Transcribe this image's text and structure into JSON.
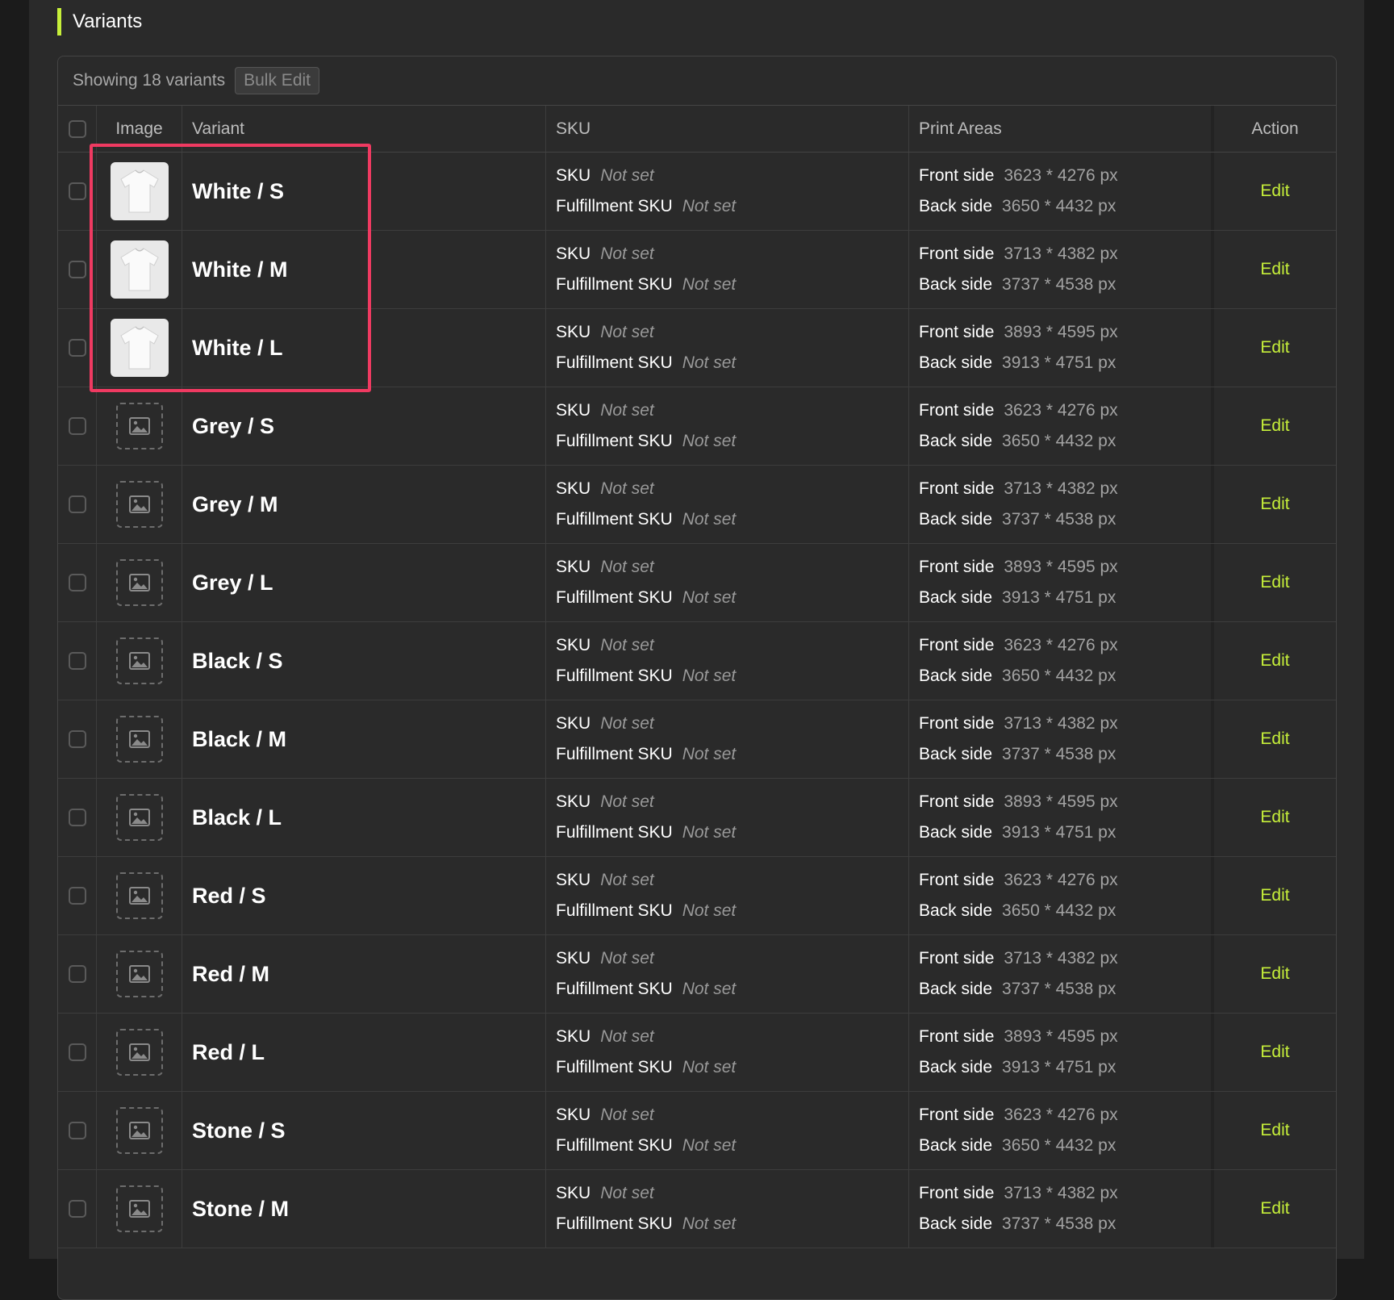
{
  "section": {
    "title": "Variants"
  },
  "toolbar": {
    "showing": "Showing 18 variants",
    "bulk_edit": "Bulk Edit"
  },
  "columns": {
    "image": "Image",
    "variant": "Variant",
    "sku": "SKU",
    "print_areas": "Print Areas",
    "action": "Action"
  },
  "colors": {
    "accent": "#c6ef3a",
    "highlight": "#ef3a61",
    "background": "#2a2a2a"
  },
  "rows": [
    {
      "variant": "White / S",
      "image": "white-tshirt",
      "sku_label": "SKU",
      "sku": "Not set",
      "fsku_label": "Fulfillment SKU",
      "fsku": "Not set",
      "front_label": "Front side",
      "front": "3623 * 4276 px",
      "back_label": "Back side",
      "back": "3650 * 4432 px",
      "action": "Edit"
    },
    {
      "variant": "White / M",
      "image": "white-tshirt",
      "sku_label": "SKU",
      "sku": "Not set",
      "fsku_label": "Fulfillment SKU",
      "fsku": "Not set",
      "front_label": "Front side",
      "front": "3713 * 4382 px",
      "back_label": "Back side",
      "back": "3737 * 4538 px",
      "action": "Edit"
    },
    {
      "variant": "White / L",
      "image": "white-tshirt",
      "sku_label": "SKU",
      "sku": "Not set",
      "fsku_label": "Fulfillment SKU",
      "fsku": "Not set",
      "front_label": "Front side",
      "front": "3893 * 4595 px",
      "back_label": "Back side",
      "back": "3913 * 4751 px",
      "action": "Edit"
    },
    {
      "variant": "Grey / S",
      "image": "placeholder",
      "sku_label": "SKU",
      "sku": "Not set",
      "fsku_label": "Fulfillment SKU",
      "fsku": "Not set",
      "front_label": "Front side",
      "front": "3623 * 4276 px",
      "back_label": "Back side",
      "back": "3650 * 4432 px",
      "action": "Edit"
    },
    {
      "variant": "Grey / M",
      "image": "placeholder",
      "sku_label": "SKU",
      "sku": "Not set",
      "fsku_label": "Fulfillment SKU",
      "fsku": "Not set",
      "front_label": "Front side",
      "front": "3713 * 4382 px",
      "back_label": "Back side",
      "back": "3737 * 4538 px",
      "action": "Edit"
    },
    {
      "variant": "Grey / L",
      "image": "placeholder",
      "sku_label": "SKU",
      "sku": "Not set",
      "fsku_label": "Fulfillment SKU",
      "fsku": "Not set",
      "front_label": "Front side",
      "front": "3893 * 4595 px",
      "back_label": "Back side",
      "back": "3913 * 4751 px",
      "action": "Edit"
    },
    {
      "variant": "Black / S",
      "image": "placeholder",
      "sku_label": "SKU",
      "sku": "Not set",
      "fsku_label": "Fulfillment SKU",
      "fsku": "Not set",
      "front_label": "Front side",
      "front": "3623 * 4276 px",
      "back_label": "Back side",
      "back": "3650 * 4432 px",
      "action": "Edit"
    },
    {
      "variant": "Black / M",
      "image": "placeholder",
      "sku_label": "SKU",
      "sku": "Not set",
      "fsku_label": "Fulfillment SKU",
      "fsku": "Not set",
      "front_label": "Front side",
      "front": "3713 * 4382 px",
      "back_label": "Back side",
      "back": "3737 * 4538 px",
      "action": "Edit"
    },
    {
      "variant": "Black / L",
      "image": "placeholder",
      "sku_label": "SKU",
      "sku": "Not set",
      "fsku_label": "Fulfillment SKU",
      "fsku": "Not set",
      "front_label": "Front side",
      "front": "3893 * 4595 px",
      "back_label": "Back side",
      "back": "3913 * 4751 px",
      "action": "Edit"
    },
    {
      "variant": "Red / S",
      "image": "placeholder",
      "sku_label": "SKU",
      "sku": "Not set",
      "fsku_label": "Fulfillment SKU",
      "fsku": "Not set",
      "front_label": "Front side",
      "front": "3623 * 4276 px",
      "back_label": "Back side",
      "back": "3650 * 4432 px",
      "action": "Edit"
    },
    {
      "variant": "Red / M",
      "image": "placeholder",
      "sku_label": "SKU",
      "sku": "Not set",
      "fsku_label": "Fulfillment SKU",
      "fsku": "Not set",
      "front_label": "Front side",
      "front": "3713 * 4382 px",
      "back_label": "Back side",
      "back": "3737 * 4538 px",
      "action": "Edit"
    },
    {
      "variant": "Red / L",
      "image": "placeholder",
      "sku_label": "SKU",
      "sku": "Not set",
      "fsku_label": "Fulfillment SKU",
      "fsku": "Not set",
      "front_label": "Front side",
      "front": "3893 * 4595 px",
      "back_label": "Back side",
      "back": "3913 * 4751 px",
      "action": "Edit"
    },
    {
      "variant": "Stone / S",
      "image": "placeholder",
      "sku_label": "SKU",
      "sku": "Not set",
      "fsku_label": "Fulfillment SKU",
      "fsku": "Not set",
      "front_label": "Front side",
      "front": "3623 * 4276 px",
      "back_label": "Back side",
      "back": "3650 * 4432 px",
      "action": "Edit"
    },
    {
      "variant": "Stone / M",
      "image": "placeholder",
      "sku_label": "SKU",
      "sku": "Not set",
      "fsku_label": "Fulfillment SKU",
      "fsku": "Not set",
      "front_label": "Front side",
      "front": "3713 * 4382 px",
      "back_label": "Back side",
      "back": "3737 * 4538 px",
      "action": "Edit"
    }
  ]
}
